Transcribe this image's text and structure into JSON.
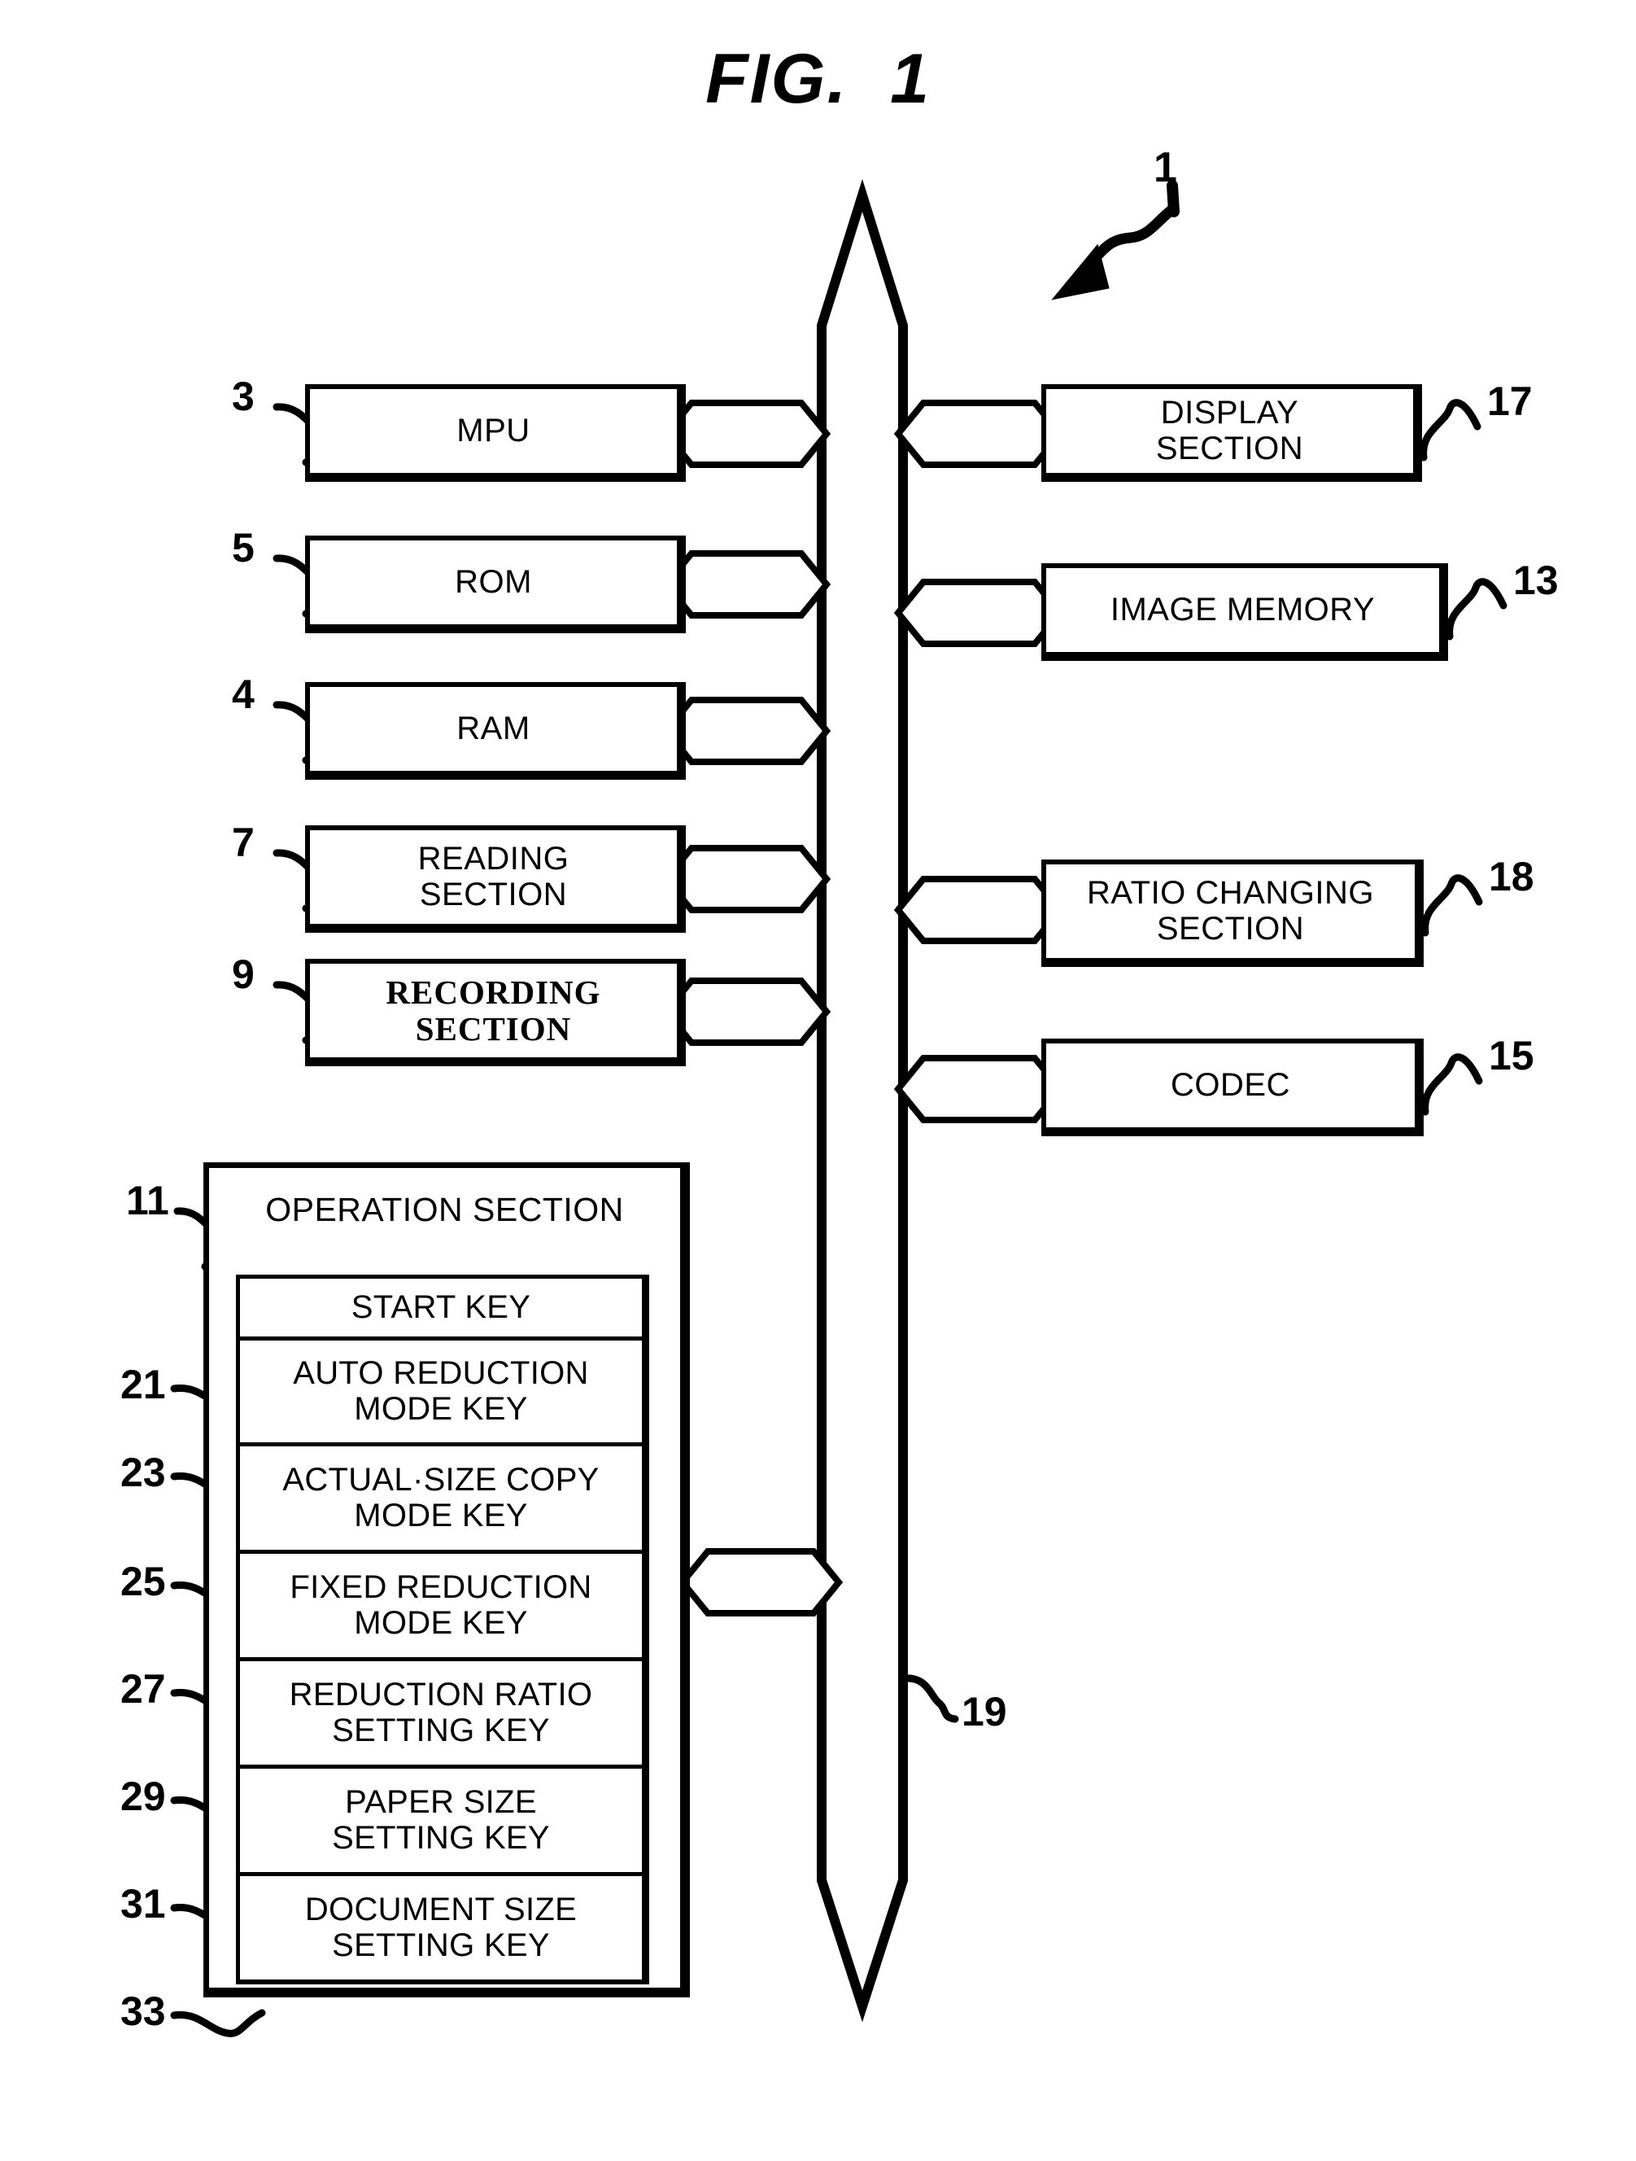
{
  "figure": {
    "title": "FIG.  1",
    "system_ref": "1",
    "bus_ref": "19"
  },
  "left_blocks": [
    {
      "ref": "3",
      "label": "MPU",
      "style": "sans"
    },
    {
      "ref": "5",
      "label": "ROM",
      "style": "sans"
    },
    {
      "ref": "4",
      "label": "RAM",
      "style": "sans"
    },
    {
      "ref": "7",
      "label": "READING\nSECTION",
      "style": "sans"
    },
    {
      "ref": "9",
      "label": "RECORDING\nSECTION",
      "style": "serif"
    }
  ],
  "right_blocks": [
    {
      "ref": "17",
      "label": "DISPLAY\nSECTION"
    },
    {
      "ref": "13",
      "label": "IMAGE MEMORY"
    },
    {
      "ref": "18",
      "label": "RATIO CHANGING\nSECTION"
    },
    {
      "ref": "15",
      "label": "CODEC"
    }
  ],
  "operation_section": {
    "ref": "11",
    "title": "OPERATION SECTION",
    "keys": [
      {
        "ref": "21",
        "label": "START KEY"
      },
      {
        "ref": "23",
        "label": "AUTO REDUCTION\nMODE KEY"
      },
      {
        "ref": "25",
        "label": "ACTUAL·SIZE COPY\nMODE KEY"
      },
      {
        "ref": "27",
        "label": "FIXED REDUCTION\nMODE KEY"
      },
      {
        "ref": "29",
        "label": "REDUCTION RATIO\nSETTING KEY"
      },
      {
        "ref": "31",
        "label": "PAPER SIZE\nSETTING KEY"
      },
      {
        "ref": "33",
        "label": "DOCUMENT SIZE\nSETTING KEY"
      }
    ]
  },
  "colors": {
    "ink": "#000000",
    "paper": "#ffffff"
  }
}
